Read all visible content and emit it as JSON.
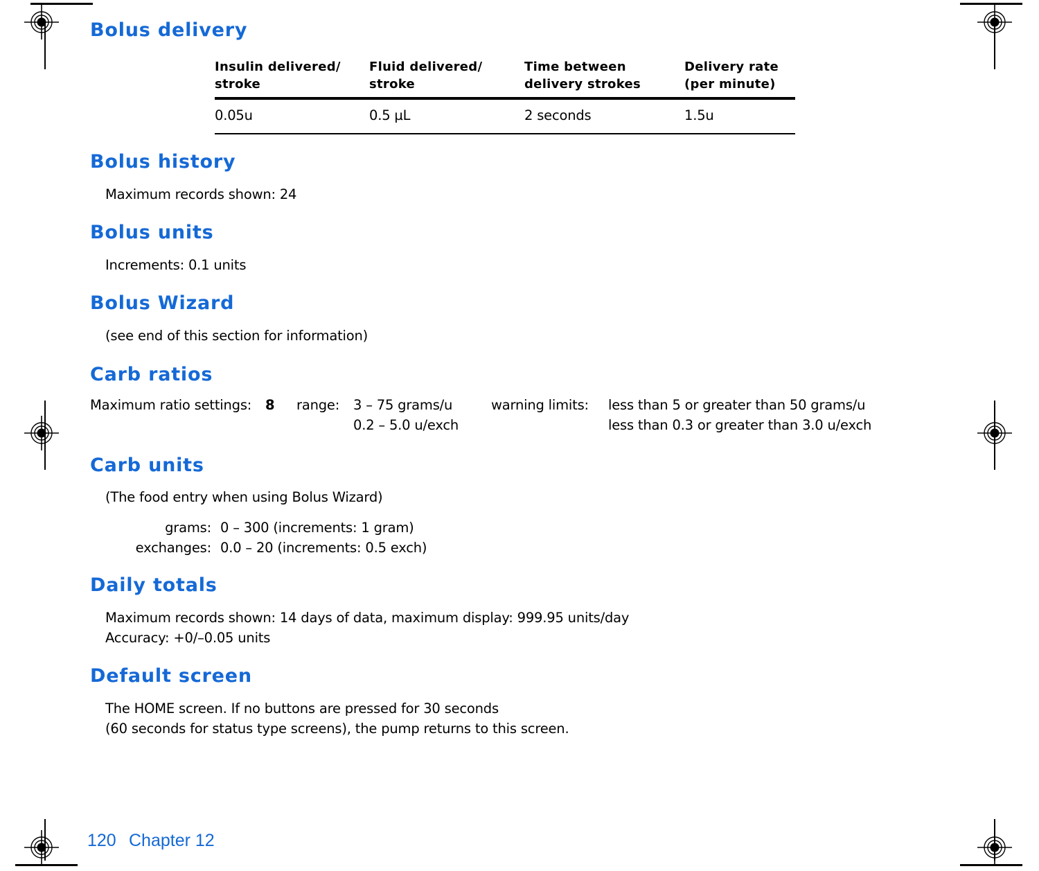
{
  "page": {
    "footer_page_number": "120",
    "footer_chapter": "Chapter 12",
    "heading_color": "#1569d6",
    "text_color": "#000000",
    "background": "#ffffff"
  },
  "sections": {
    "bolus_delivery": {
      "heading": "Bolus delivery",
      "table": {
        "columns": [
          "Insulin delivered/\nstroke",
          "Fluid delivered/\nstroke",
          "Time between\ndelivery strokes",
          "Delivery rate\n(per minute)"
        ],
        "rows": [
          [
            "0.05u",
            "0.5 µL",
            "2 seconds",
            "1.5u"
          ]
        ]
      }
    },
    "bolus_history": {
      "heading": "Bolus history",
      "lines": [
        "Maximum records shown: 24"
      ]
    },
    "bolus_units": {
      "heading": "Bolus units",
      "lines": [
        "Increments: 0.1 units"
      ]
    },
    "bolus_wizard": {
      "heading": "Bolus Wizard",
      "lines": [
        "(see end of this section for information)"
      ]
    },
    "carb_ratios": {
      "heading": "Carb ratios",
      "max_settings_label": "Maximum ratio settings:",
      "max_settings_value": "8",
      "range_label": "range:",
      "range_values": [
        "3 – 75 grams/u",
        "0.2 – 5.0 u/exch"
      ],
      "warning_limits_label": "warning limits:",
      "warning_limits_values": [
        "less than 5 or greater than 50 grams/u",
        "less than 0.3 or greater than 3.0 u/exch"
      ]
    },
    "carb_units": {
      "heading": "Carb units",
      "note": "(The food entry when using Bolus Wizard)",
      "entries": [
        {
          "label": "grams:",
          "value": "0 – 300 (increments:  1 gram)"
        },
        {
          "label": "exchanges:",
          "value": "0.0 – 20 (increments:  0.5 exch)"
        }
      ]
    },
    "daily_totals": {
      "heading": "Daily totals",
      "lines": [
        "Maximum records shown: 14 days of data, maximum display: 999.95 units/day",
        "Accuracy: +0/–0.05 units"
      ]
    },
    "default_screen": {
      "heading": "Default screen",
      "lines": [
        "The HOME screen. If no buttons are pressed for 30 seconds",
        "(60 seconds for status type screens), the pump returns to this screen."
      ]
    }
  }
}
